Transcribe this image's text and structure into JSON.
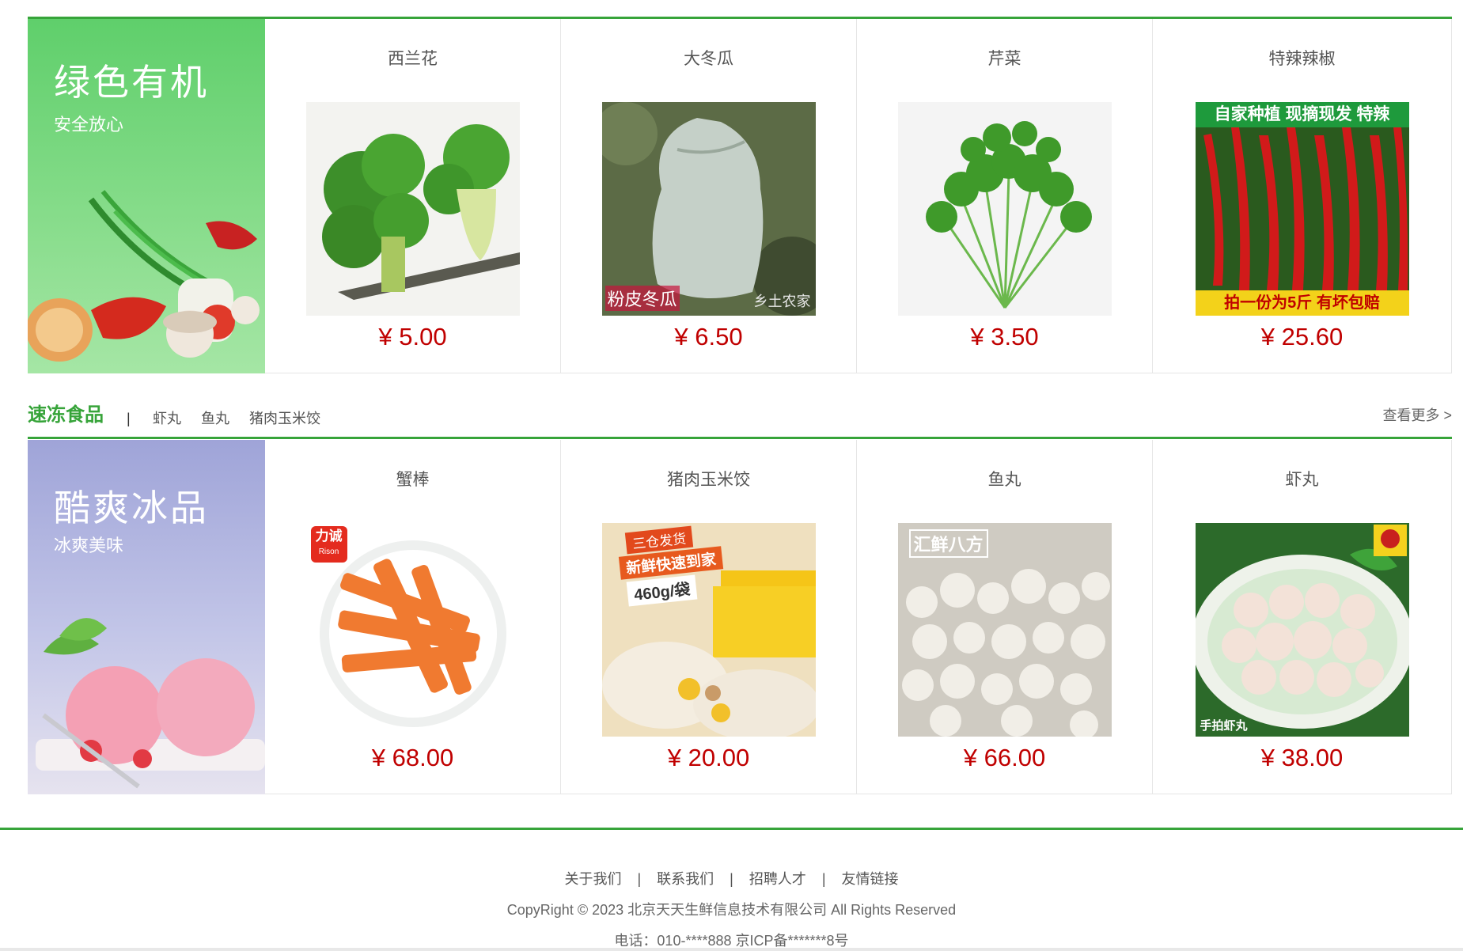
{
  "sections": [
    {
      "title": "",
      "tags": [
        "",
        ""
      ],
      "more": "",
      "banner": {
        "title": "绿色有机",
        "subtitle": "安全放心"
      },
      "products": [
        {
          "name": "西兰花",
          "price": "¥ 5.00"
        },
        {
          "name": "大冬瓜",
          "price": "¥ 6.50"
        },
        {
          "name": "芹菜",
          "price": "¥ 3.50"
        },
        {
          "name": "特辣辣椒",
          "price": "¥ 25.60"
        }
      ]
    },
    {
      "title": "速冻食品",
      "separator": "|",
      "tags": [
        "虾丸",
        "鱼丸",
        "猪肉玉米饺"
      ],
      "more": "查看更多 >",
      "banner": {
        "title": "酷爽冰品",
        "subtitle": "冰爽美味"
      },
      "products": [
        {
          "name": "蟹棒",
          "price": "¥ 68.00"
        },
        {
          "name": "猪肉玉米饺",
          "price": "¥ 20.00"
        },
        {
          "name": "鱼丸",
          "price": "¥ 66.00"
        },
        {
          "name": "虾丸",
          "price": "¥ 38.00"
        }
      ]
    }
  ],
  "image_text": {
    "wintermelon_left": "粉皮冬瓜",
    "wintermelon_right": "乡土农家",
    "pepper_top": "自家种植 现摘现发 特辣",
    "pepper_bottom": "拍一份为5斤 有坏包赔",
    "crab_brand": "力诚",
    "crab_brand_en": "Rison",
    "dumpling_line1": "三仓发货",
    "dumpling_line2": "新鲜快速到家",
    "dumpling_line3": "460g/袋",
    "fishball_brand": "汇鲜八方",
    "shrimpball_caption": "手拍虾丸"
  },
  "footer": {
    "links": [
      "关于我们",
      "联系我们",
      "招聘人才",
      "友情链接"
    ],
    "separator": "|",
    "copyright": "CopyRight © 2023 北京天天生鲜信息技术有限公司 All Rights Reserved",
    "contact": "电话：010-****888 京ICP备*******8号"
  },
  "colors": {
    "accent": "#37a43a",
    "price": "#c00000"
  }
}
